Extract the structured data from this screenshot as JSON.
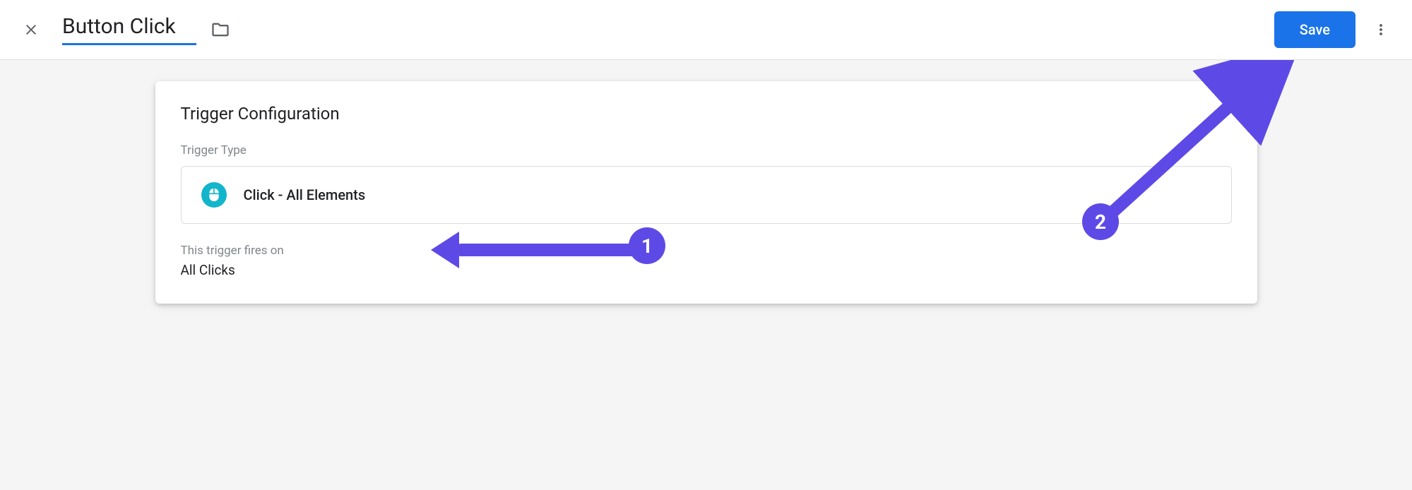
{
  "header": {
    "title_value": "Button Click",
    "save_label": "Save"
  },
  "card": {
    "title": "Trigger Configuration",
    "trigger_type_label": "Trigger Type",
    "trigger_type_value": "Click - All Elements",
    "fires_on_label": "This trigger fires on",
    "fires_on_value": "All Clicks"
  },
  "annotations": {
    "badge1": "1",
    "badge2": "2"
  }
}
